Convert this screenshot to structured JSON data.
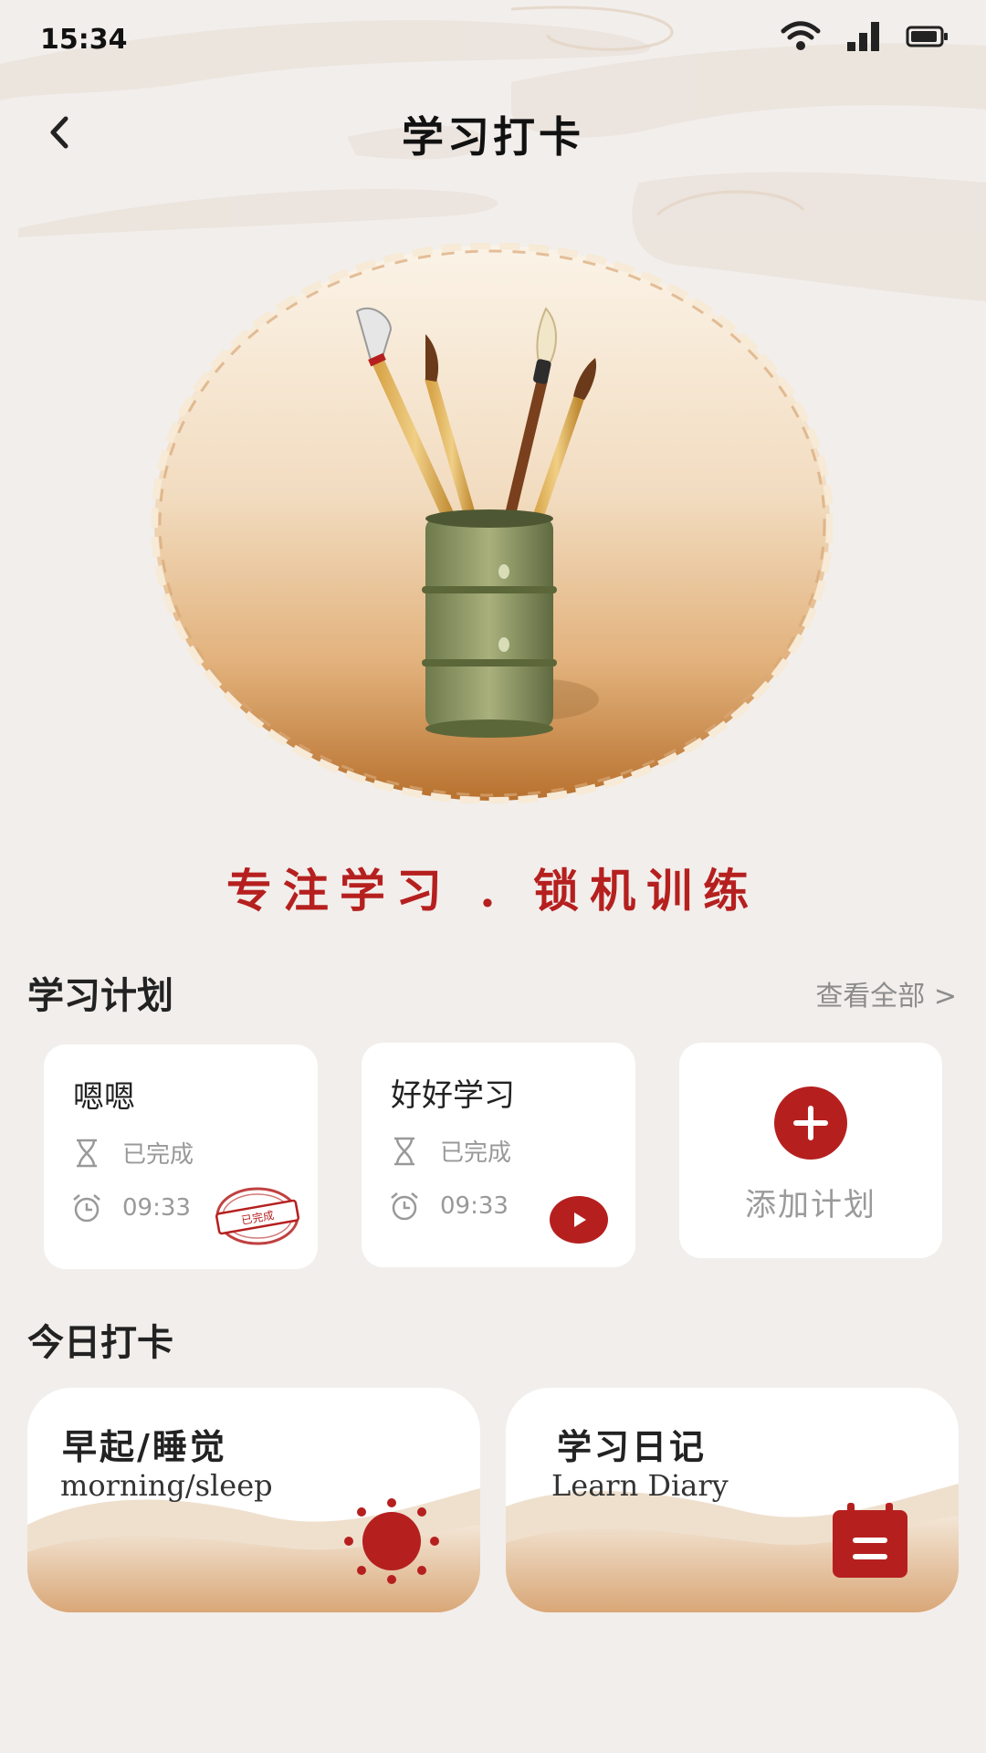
{
  "status_bar": {
    "time": "15:34",
    "icons": [
      "wifi-icon",
      "signal-icon",
      "battery-icon"
    ]
  },
  "nav": {
    "title": "学习打卡",
    "back_icon": "chevron-left-icon"
  },
  "hero": {
    "image": "brush-holder-illustration",
    "slogan": "专注学习 . 锁机训练"
  },
  "plans": {
    "title": "学习计划",
    "view_all": "查看全部 >",
    "items": [
      {
        "name": "嗯嗯",
        "status": "已完成",
        "time": "09:33",
        "badge": "已完成"
      },
      {
        "name": "好好学习",
        "status": "已完成",
        "time": "09:33",
        "action_icon": "play-icon"
      }
    ],
    "add_label": "添加计划"
  },
  "checkin": {
    "title": "今日打卡",
    "cards": [
      {
        "cn": "早起/睡觉",
        "en": "morning/sleep",
        "icon": "sun-icon"
      },
      {
        "cn": "学习日记",
        "en": "Learn Diary",
        "icon": "calendar-icon"
      }
    ]
  },
  "colors": {
    "accent": "#b5201f",
    "background": "#f2eeeb",
    "card": "#ffffff",
    "muted": "#999999"
  }
}
